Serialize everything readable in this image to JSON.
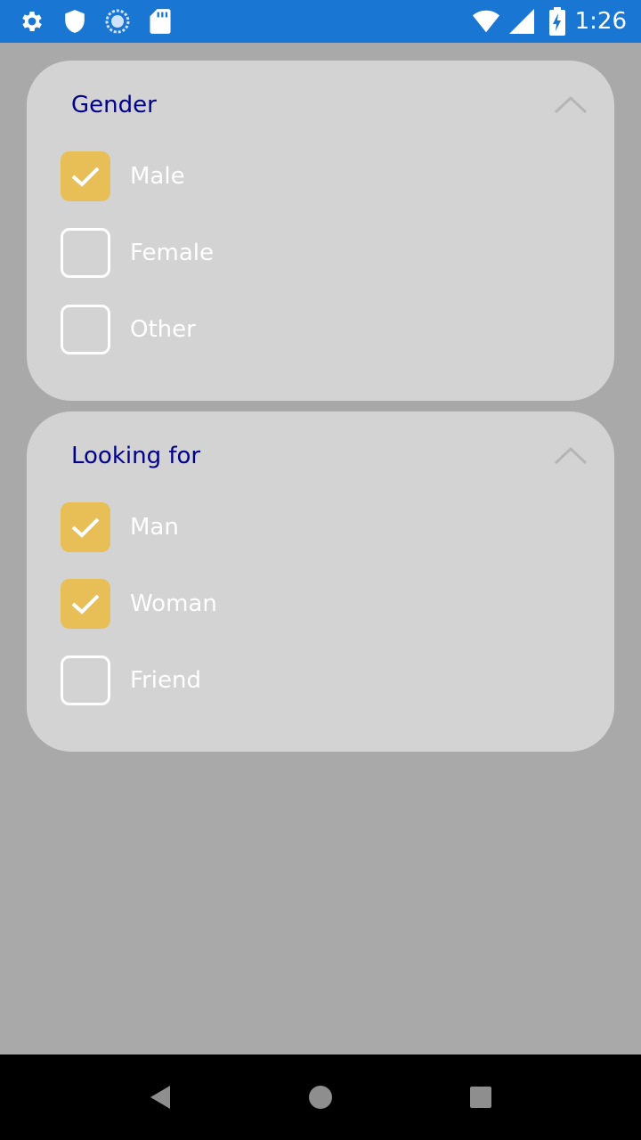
{
  "status_bar": {
    "time": "1:26",
    "color": "#1976d2",
    "left_icons": [
      "gear-icon",
      "shield-icon",
      "sync-icon",
      "sd-card-icon"
    ],
    "right_icons": [
      "wifi-icon",
      "signal-icon",
      "battery-charging-icon"
    ]
  },
  "gender": {
    "title": "Gender",
    "options": [
      {
        "label": "Male",
        "checked": true
      },
      {
        "label": "Female",
        "checked": false
      },
      {
        "label": "Other",
        "checked": false
      }
    ]
  },
  "looking_for": {
    "title": "Looking for",
    "options": [
      {
        "label": "Man",
        "checked": true
      },
      {
        "label": "Woman",
        "checked": true
      },
      {
        "label": "Friend",
        "checked": false
      }
    ]
  },
  "colors": {
    "background": "#a9a9a9",
    "panel": "#d3d3d3",
    "title": "#00008b",
    "checkbox_checked": "#e8bf57"
  },
  "nav_bar": {
    "buttons": [
      "back-icon",
      "home-icon",
      "recents-icon"
    ]
  }
}
